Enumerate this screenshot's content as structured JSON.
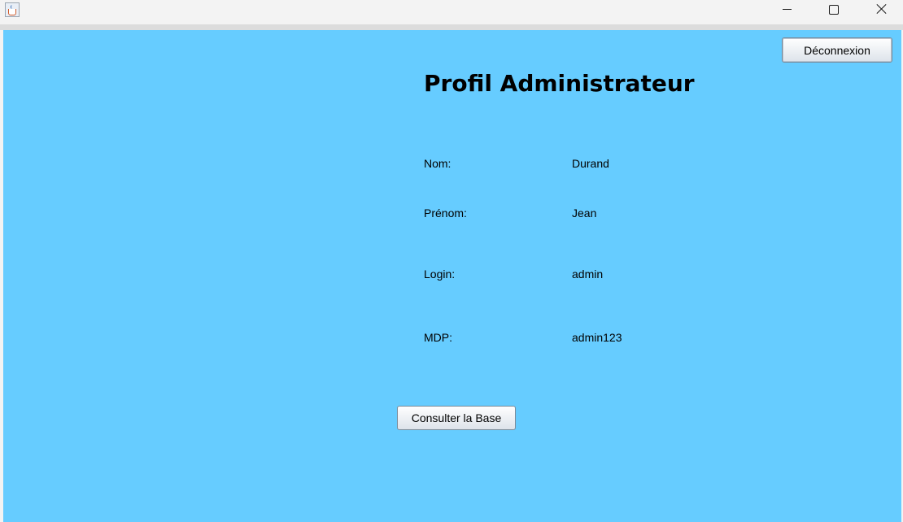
{
  "window": {
    "controls": {
      "minimize_icon": "minimize-icon",
      "maximize_icon": "maximize-icon",
      "close_icon": "close-icon"
    },
    "app_icon": "java-cup-icon"
  },
  "colors": {
    "content_background": "#66ccff",
    "titlebar_background": "#f3f3f3"
  },
  "header": {
    "logout_label": "Déconnexion",
    "title": "Profil Administrateur"
  },
  "profile": {
    "fields": [
      {
        "label": "Nom:",
        "value": "Durand"
      },
      {
        "label": "Prénom:",
        "value": "Jean"
      },
      {
        "label": "Login:",
        "value": "admin"
      },
      {
        "label": "MDP:",
        "value": "admin123"
      }
    ]
  },
  "actions": {
    "consult_label": "Consulter la Base"
  }
}
